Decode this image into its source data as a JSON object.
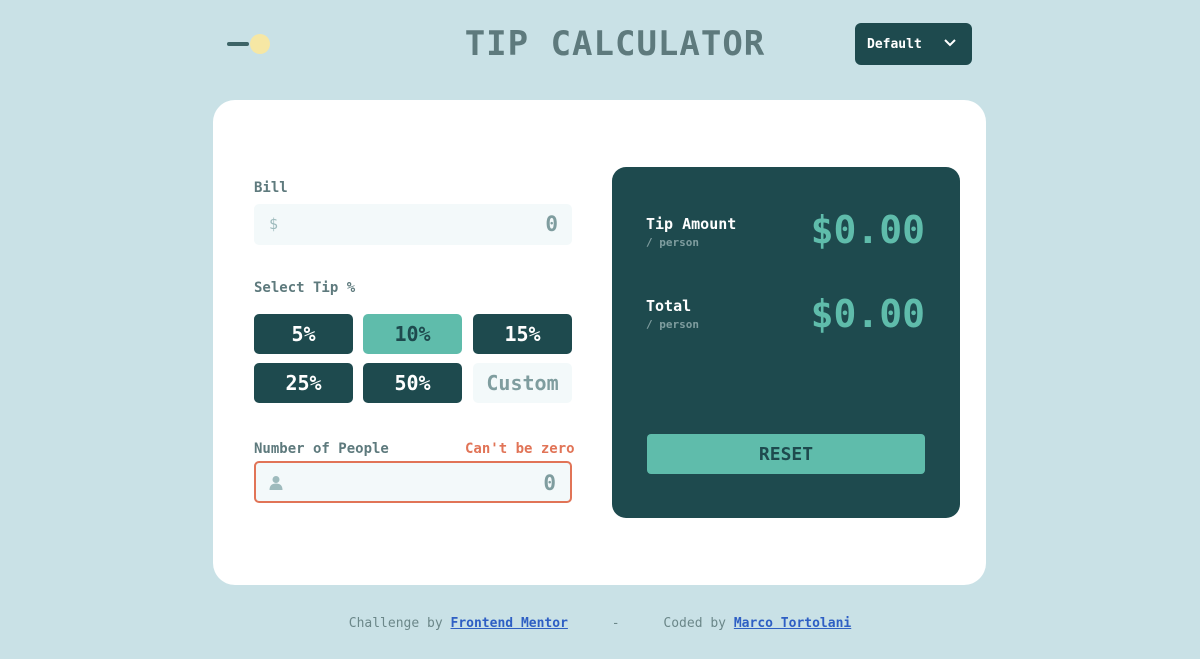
{
  "header": {
    "title": "TIP CALCULATOR",
    "theme_select": {
      "label": "Default",
      "icon": "chevron-down-icon"
    },
    "theme_toggle_icon": "sun-toggle-icon"
  },
  "form": {
    "bill": {
      "label": "Bill",
      "prefix": "$",
      "value": "0"
    },
    "tip": {
      "label": "Select Tip %",
      "options": [
        "5%",
        "10%",
        "15%",
        "25%",
        "50%"
      ],
      "selected": "10%",
      "custom_placeholder": "Custom"
    },
    "people": {
      "label": "Number of People",
      "error": "Can't be zero",
      "value": "0",
      "icon": "person-icon"
    }
  },
  "results": {
    "tip_amount": {
      "title": "Tip Amount",
      "sub": "/ person",
      "value": "$0.00"
    },
    "total": {
      "title": "Total",
      "sub": "/ person",
      "value": "$0.00"
    },
    "reset_label": "RESET"
  },
  "footer": {
    "challenge_prefix": "Challenge by",
    "challenge_link": "Frontend Mentor",
    "separator": "-",
    "coded_prefix": "Coded by",
    "coded_link": "Marco Tortolani"
  },
  "colors": {
    "background": "#c9e1e6",
    "dark_teal": "#1e4a4e",
    "accent": "#5fbcab",
    "error": "#e17457",
    "sun": "#f6e7a4"
  }
}
